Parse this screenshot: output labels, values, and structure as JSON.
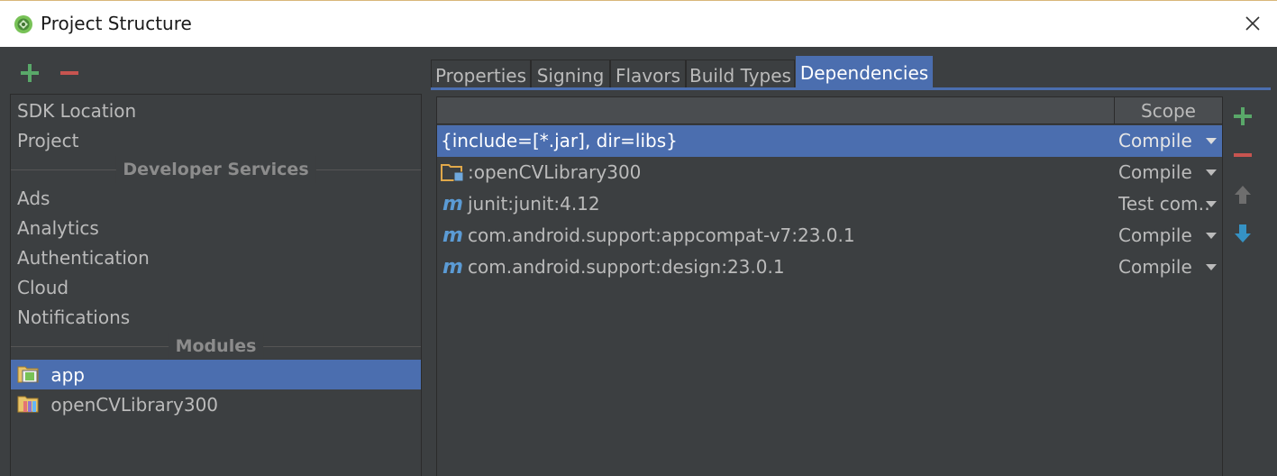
{
  "window": {
    "title": "Project Structure",
    "app_icon": "android-studio-icon",
    "close_icon": "close-icon"
  },
  "left_toolbar": {
    "add_icon": "plus-icon",
    "remove_icon": "minus-icon"
  },
  "sidebar": {
    "top_items": [
      {
        "label": "SDK Location"
      },
      {
        "label": "Project"
      }
    ],
    "developer_services_header": "Developer Services",
    "service_items": [
      {
        "label": "Ads"
      },
      {
        "label": "Analytics"
      },
      {
        "label": "Authentication"
      },
      {
        "label": "Cloud"
      },
      {
        "label": "Notifications"
      }
    ],
    "modules_header": "Modules",
    "modules": [
      {
        "label": "app",
        "icon": "app-module-icon",
        "selected": true
      },
      {
        "label": "openCVLibrary300",
        "icon": "library-module-icon",
        "selected": false
      }
    ]
  },
  "tabs": [
    {
      "label": "Properties",
      "active": false
    },
    {
      "label": "Signing",
      "active": false
    },
    {
      "label": "Flavors",
      "active": false
    },
    {
      "label": "Build Types",
      "active": false
    },
    {
      "label": "Dependencies",
      "active": true
    }
  ],
  "dependencies": {
    "scope_header": "Scope",
    "rows": [
      {
        "name": "{include=[*.jar], dir=libs}",
        "scope": "Compile",
        "icon": "",
        "selected": true
      },
      {
        "name": ":openCVLibrary300",
        "scope": "Compile",
        "icon": "module-folder-icon",
        "selected": false
      },
      {
        "name": "junit:junit:4.12",
        "scope": "Test com…",
        "icon": "maven-icon",
        "selected": false
      },
      {
        "name": "com.android.support:appcompat-v7:23.0.1",
        "scope": "Compile",
        "icon": "maven-icon",
        "selected": false
      },
      {
        "name": "com.android.support:design:23.0.1",
        "scope": "Compile",
        "icon": "maven-icon",
        "selected": false
      }
    ]
  },
  "right_toolbar": {
    "add_icon": "plus-icon",
    "remove_icon": "minus-icon",
    "move_up_icon": "arrow-up-icon",
    "move_down_icon": "arrow-down-icon"
  },
  "colors": {
    "selection": "#4b6eaf",
    "background": "#3c3f41",
    "add_green": "#59a869",
    "remove_red": "#c75450",
    "down_blue": "#3592c4"
  }
}
